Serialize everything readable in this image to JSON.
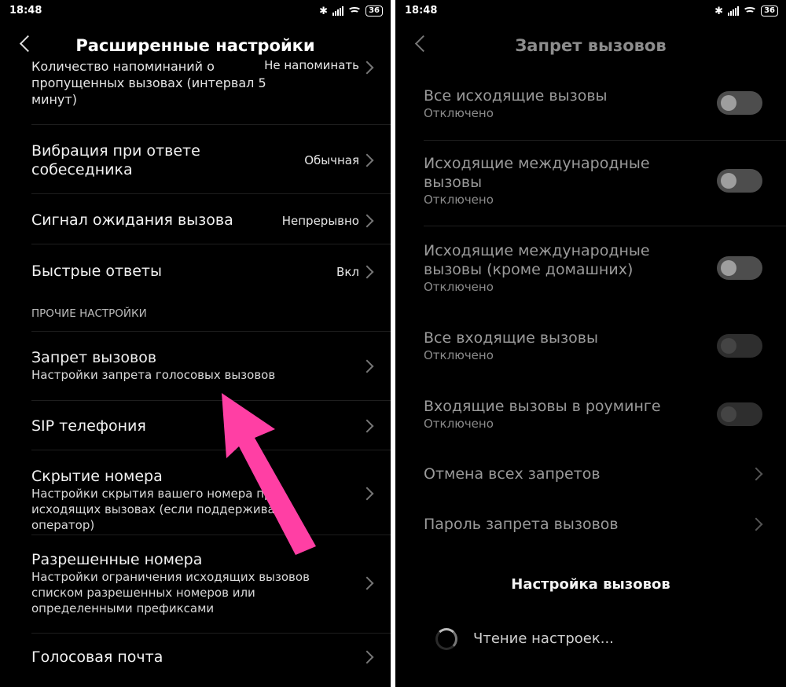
{
  "status": {
    "time": "18:48",
    "battery": "36"
  },
  "left": {
    "title": "Расширенные настройки",
    "top_cut": {
      "title": "Количество напоминаний о пропущенных вызовах (интервал 5 минут)",
      "value": "Не напоминать"
    },
    "rows": [
      {
        "title": "Вибрация при ответе собеседника",
        "value": "Обычная"
      },
      {
        "title": "Сигнал ожидания вызова",
        "value": "Непрерывно"
      },
      {
        "title": "Быстрые ответы",
        "value": "Вкл"
      }
    ],
    "section_label": "ПРОЧИЕ НАСТРОЙКИ",
    "items": [
      {
        "title": "Запрет вызовов",
        "subtitle": "Настройки запрета голосовых вызовов"
      },
      {
        "title": "SIP телефония"
      },
      {
        "title": "Скрытие номера",
        "subtitle": "Настройки скрытия вашего номера при исходящих вызовах (если поддерживает оператор)"
      },
      {
        "title": "Разрешенные номера",
        "subtitle": "Настройки ограничения исходящих вызовов списком разрешенных номеров или определенными префиксами"
      },
      {
        "title": "Голосовая почта"
      }
    ],
    "annotation_color": "#ff3fa4"
  },
  "right": {
    "title": "Запрет вызовов",
    "toggles": [
      {
        "title": "Все исходящие вызовы",
        "status": "Отключено"
      },
      {
        "title": "Исходящие международные вызовы",
        "status": "Отключено"
      },
      {
        "title": "Исходящие международные вызовы (кроме домашних)",
        "status": "Отключено"
      },
      {
        "title": "Все входящие вызовы",
        "status": "Отключено"
      },
      {
        "title": "Входящие вызовы в роуминге",
        "status": "Отключено"
      }
    ],
    "links": [
      {
        "title": "Отмена всех запретов"
      },
      {
        "title": "Пароль запрета вызовов"
      }
    ],
    "dialog": {
      "title": "Настройка вызовов",
      "message": "Чтение настроек..."
    }
  }
}
